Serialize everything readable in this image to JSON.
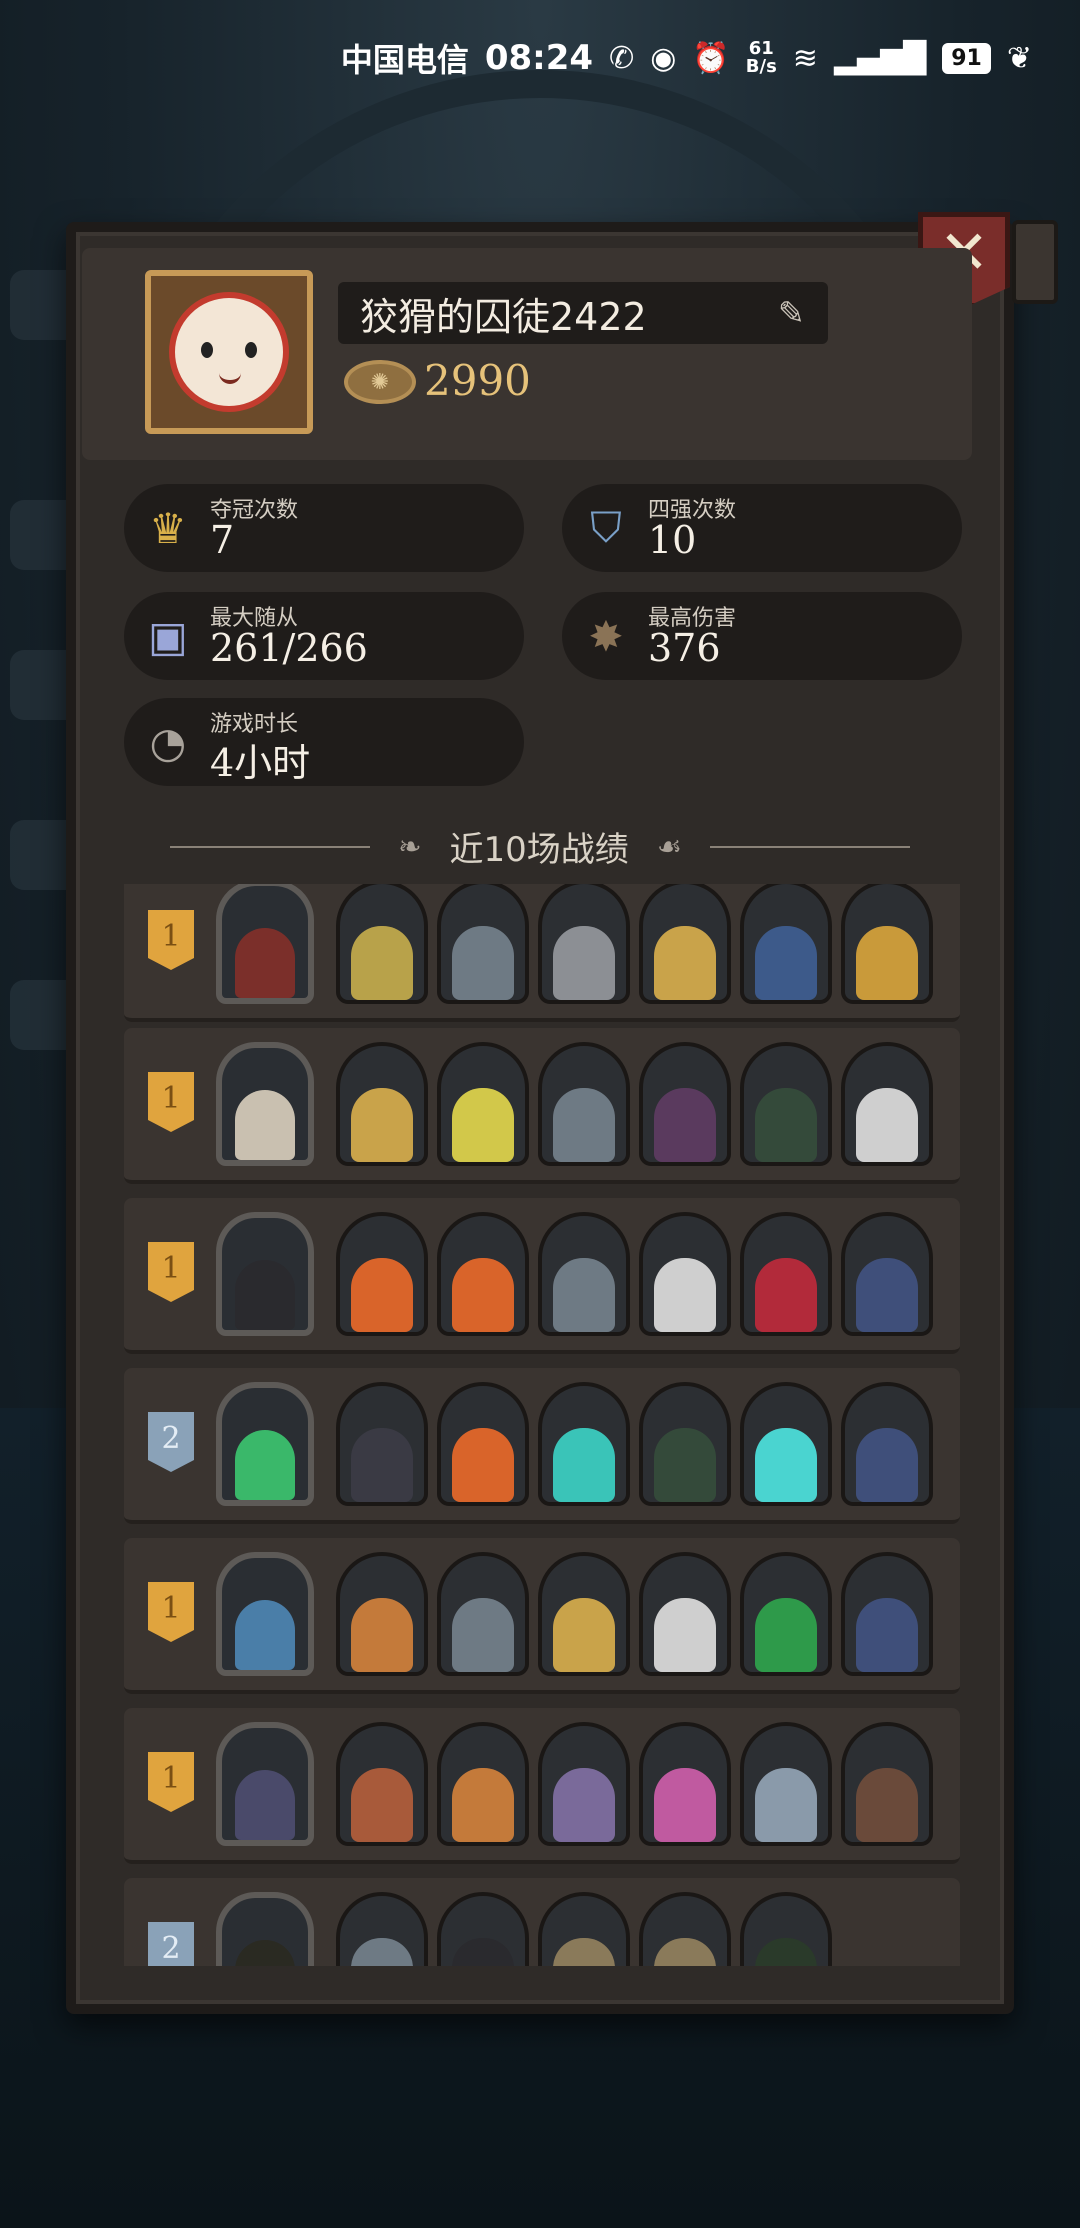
{
  "status_bar": {
    "carrier": "中国电信",
    "time": "08:24",
    "net_speed_top": "61",
    "net_speed_unit": "B/s",
    "battery": "91"
  },
  "profile": {
    "name": "狡猾的囚徒2422",
    "coins": "2990"
  },
  "stats": {
    "championships": {
      "label": "夺冠次数",
      "value": "7"
    },
    "top_four": {
      "label": "四强次数",
      "value": "10"
    },
    "max_followers": {
      "label": "最大随从",
      "value": "261/266"
    },
    "max_damage": {
      "label": "最高伤害",
      "value": "376"
    },
    "play_time": {
      "label": "游戏时长",
      "value": "4小时"
    }
  },
  "section": {
    "recent_matches_title": "近10场战绩"
  },
  "matches": [
    {
      "rank": "1",
      "rank_color": "#e0a43e",
      "hero_color": "#7b2f2a",
      "units": [
        "#b8a24a",
        "#6e7a84",
        "#8c8f94",
        "#c9a34a",
        "#3d5a8a",
        "#c99a3a"
      ]
    },
    {
      "rank": "1",
      "rank_color": "#e0a43e",
      "hero_color": "#c9c0b0",
      "units": [
        "#c9a34a",
        "#d2c84a",
        "#6e7a84",
        "#5a3a5e",
        "#344a3a",
        "#cfcfcf"
      ]
    },
    {
      "rank": "1",
      "rank_color": "#e0a43e",
      "hero_color": "#2a2a2e",
      "units": [
        "#d9642a",
        "#d9642a",
        "#6e7a84",
        "#cfcfcf",
        "#b22a3a",
        "#3f4f7a"
      ]
    },
    {
      "rank": "2",
      "rank_color": "#8aa2b8",
      "hero_color": "#3ab86a",
      "units": [
        "#3a3a44",
        "#d9642a",
        "#3ac4b8",
        "#344a3a",
        "#4ad4d0",
        "#3f4f7a"
      ]
    },
    {
      "rank": "1",
      "rank_color": "#e0a43e",
      "hero_color": "#4a7ea8",
      "units": [
        "#c47a3a",
        "#6e7a84",
        "#c9a34a",
        "#cfcfcf",
        "#2e9a4a",
        "#3f4f7a"
      ]
    },
    {
      "rank": "1",
      "rank_color": "#e0a43e",
      "hero_color": "#4a4a6a",
      "units": [
        "#a85a3a",
        "#c47a3a",
        "#7a6a9a",
        "#c05aa0",
        "#8a9aaa",
        "#6a4a3a"
      ]
    },
    {
      "rank": "2",
      "rank_color": "#8aa2b8",
      "hero_color": "#2a2a22",
      "units": [
        "#6e7a84",
        "#2a2a2e",
        "#8a7a5a",
        "#8a7a5a",
        "#2a3a2a"
      ]
    }
  ]
}
